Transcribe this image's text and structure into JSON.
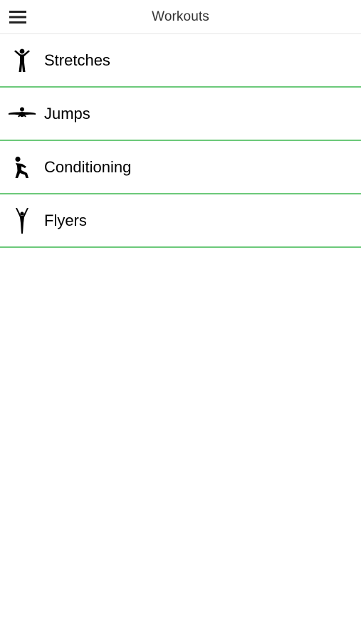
{
  "header": {
    "title": "Workouts",
    "menu_icon": "hamburger-menu-icon"
  },
  "workouts": [
    {
      "label": "Stretches",
      "icon": "stretch-figure-icon"
    },
    {
      "label": "Jumps",
      "icon": "jump-figure-icon"
    },
    {
      "label": "Conditioning",
      "icon": "conditioning-figure-icon"
    },
    {
      "label": "Flyers",
      "icon": "flyer-figure-icon"
    }
  ],
  "colors": {
    "divider": "#6cc97a",
    "header_border": "#e6e6e6",
    "icon": "#000000"
  }
}
